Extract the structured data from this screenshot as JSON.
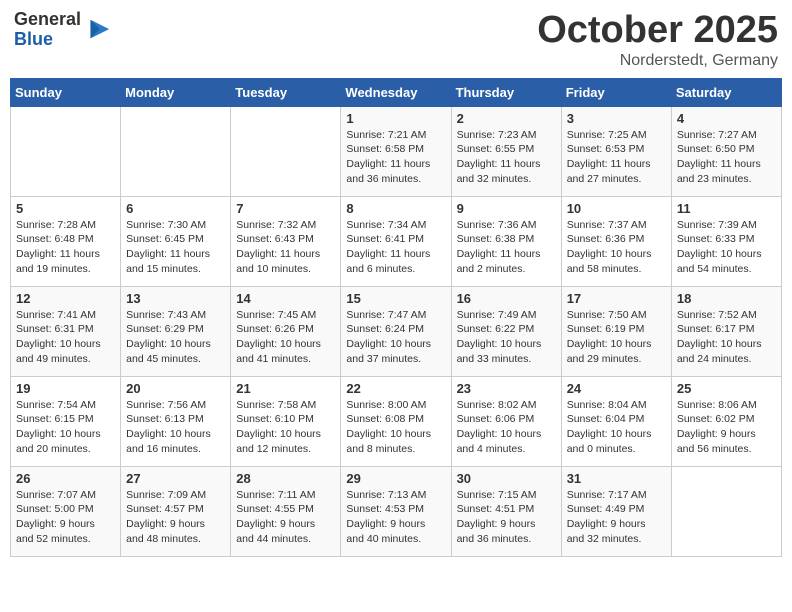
{
  "logo": {
    "general": "General",
    "blue": "Blue"
  },
  "title": "October 2025",
  "location": "Norderstedt, Germany",
  "days_header": [
    "Sunday",
    "Monday",
    "Tuesday",
    "Wednesday",
    "Thursday",
    "Friday",
    "Saturday"
  ],
  "weeks": [
    [
      {
        "day": "",
        "info": ""
      },
      {
        "day": "",
        "info": ""
      },
      {
        "day": "",
        "info": ""
      },
      {
        "day": "1",
        "info": "Sunrise: 7:21 AM\nSunset: 6:58 PM\nDaylight: 11 hours\nand 36 minutes."
      },
      {
        "day": "2",
        "info": "Sunrise: 7:23 AM\nSunset: 6:55 PM\nDaylight: 11 hours\nand 32 minutes."
      },
      {
        "day": "3",
        "info": "Sunrise: 7:25 AM\nSunset: 6:53 PM\nDaylight: 11 hours\nand 27 minutes."
      },
      {
        "day": "4",
        "info": "Sunrise: 7:27 AM\nSunset: 6:50 PM\nDaylight: 11 hours\nand 23 minutes."
      }
    ],
    [
      {
        "day": "5",
        "info": "Sunrise: 7:28 AM\nSunset: 6:48 PM\nDaylight: 11 hours\nand 19 minutes."
      },
      {
        "day": "6",
        "info": "Sunrise: 7:30 AM\nSunset: 6:45 PM\nDaylight: 11 hours\nand 15 minutes."
      },
      {
        "day": "7",
        "info": "Sunrise: 7:32 AM\nSunset: 6:43 PM\nDaylight: 11 hours\nand 10 minutes."
      },
      {
        "day": "8",
        "info": "Sunrise: 7:34 AM\nSunset: 6:41 PM\nDaylight: 11 hours\nand 6 minutes."
      },
      {
        "day": "9",
        "info": "Sunrise: 7:36 AM\nSunset: 6:38 PM\nDaylight: 11 hours\nand 2 minutes."
      },
      {
        "day": "10",
        "info": "Sunrise: 7:37 AM\nSunset: 6:36 PM\nDaylight: 10 hours\nand 58 minutes."
      },
      {
        "day": "11",
        "info": "Sunrise: 7:39 AM\nSunset: 6:33 PM\nDaylight: 10 hours\nand 54 minutes."
      }
    ],
    [
      {
        "day": "12",
        "info": "Sunrise: 7:41 AM\nSunset: 6:31 PM\nDaylight: 10 hours\nand 49 minutes."
      },
      {
        "day": "13",
        "info": "Sunrise: 7:43 AM\nSunset: 6:29 PM\nDaylight: 10 hours\nand 45 minutes."
      },
      {
        "day": "14",
        "info": "Sunrise: 7:45 AM\nSunset: 6:26 PM\nDaylight: 10 hours\nand 41 minutes."
      },
      {
        "day": "15",
        "info": "Sunrise: 7:47 AM\nSunset: 6:24 PM\nDaylight: 10 hours\nand 37 minutes."
      },
      {
        "day": "16",
        "info": "Sunrise: 7:49 AM\nSunset: 6:22 PM\nDaylight: 10 hours\nand 33 minutes."
      },
      {
        "day": "17",
        "info": "Sunrise: 7:50 AM\nSunset: 6:19 PM\nDaylight: 10 hours\nand 29 minutes."
      },
      {
        "day": "18",
        "info": "Sunrise: 7:52 AM\nSunset: 6:17 PM\nDaylight: 10 hours\nand 24 minutes."
      }
    ],
    [
      {
        "day": "19",
        "info": "Sunrise: 7:54 AM\nSunset: 6:15 PM\nDaylight: 10 hours\nand 20 minutes."
      },
      {
        "day": "20",
        "info": "Sunrise: 7:56 AM\nSunset: 6:13 PM\nDaylight: 10 hours\nand 16 minutes."
      },
      {
        "day": "21",
        "info": "Sunrise: 7:58 AM\nSunset: 6:10 PM\nDaylight: 10 hours\nand 12 minutes."
      },
      {
        "day": "22",
        "info": "Sunrise: 8:00 AM\nSunset: 6:08 PM\nDaylight: 10 hours\nand 8 minutes."
      },
      {
        "day": "23",
        "info": "Sunrise: 8:02 AM\nSunset: 6:06 PM\nDaylight: 10 hours\nand 4 minutes."
      },
      {
        "day": "24",
        "info": "Sunrise: 8:04 AM\nSunset: 6:04 PM\nDaylight: 10 hours\nand 0 minutes."
      },
      {
        "day": "25",
        "info": "Sunrise: 8:06 AM\nSunset: 6:02 PM\nDaylight: 9 hours\nand 56 minutes."
      }
    ],
    [
      {
        "day": "26",
        "info": "Sunrise: 7:07 AM\nSunset: 5:00 PM\nDaylight: 9 hours\nand 52 minutes."
      },
      {
        "day": "27",
        "info": "Sunrise: 7:09 AM\nSunset: 4:57 PM\nDaylight: 9 hours\nand 48 minutes."
      },
      {
        "day": "28",
        "info": "Sunrise: 7:11 AM\nSunset: 4:55 PM\nDaylight: 9 hours\nand 44 minutes."
      },
      {
        "day": "29",
        "info": "Sunrise: 7:13 AM\nSunset: 4:53 PM\nDaylight: 9 hours\nand 40 minutes."
      },
      {
        "day": "30",
        "info": "Sunrise: 7:15 AM\nSunset: 4:51 PM\nDaylight: 9 hours\nand 36 minutes."
      },
      {
        "day": "31",
        "info": "Sunrise: 7:17 AM\nSunset: 4:49 PM\nDaylight: 9 hours\nand 32 minutes."
      },
      {
        "day": "",
        "info": ""
      }
    ]
  ]
}
